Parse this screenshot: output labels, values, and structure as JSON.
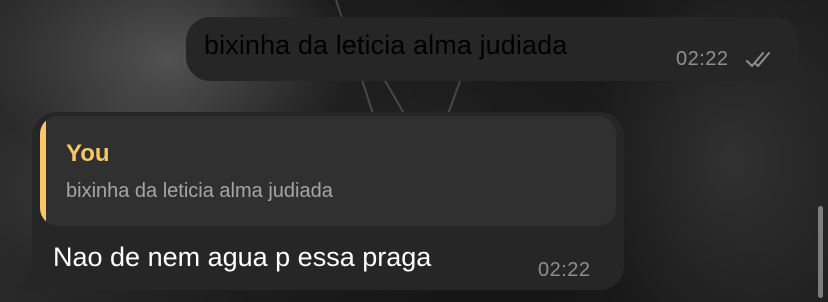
{
  "messages": {
    "outgoing": {
      "text": "bixinha da leticia alma judiada",
      "time": "02:22",
      "status_icon": "double-check-read-icon"
    },
    "incoming": {
      "reply": {
        "sender": "You",
        "text": "bixinha da leticia alma judiada"
      },
      "text": "Nao de nem agua p essa praga",
      "time": "02:22"
    }
  },
  "colors": {
    "bubble": "#262626",
    "reply_block": "#303030",
    "reply_accent": "#f6c863",
    "timestamp": "#8e8e93"
  }
}
